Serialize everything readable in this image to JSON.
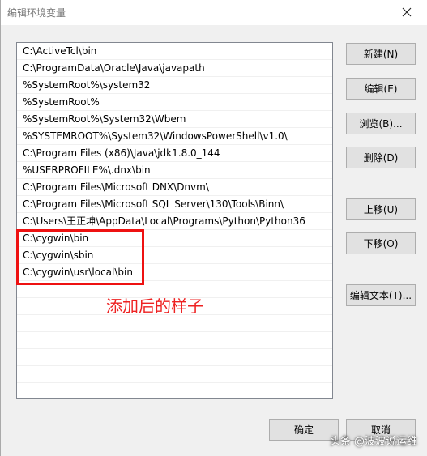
{
  "window": {
    "title": "编辑环境变量"
  },
  "paths": [
    "C:\\ActiveTcl\\bin",
    "C:\\ProgramData\\Oracle\\Java\\javapath",
    "%SystemRoot%\\system32",
    "%SystemRoot%",
    "%SystemRoot%\\System32\\Wbem",
    "%SYSTEMROOT%\\System32\\WindowsPowerShell\\v1.0\\",
    "C:\\Program Files (x86)\\Java\\jdk1.8.0_144",
    "%USERPROFILE%\\.dnx\\bin",
    "C:\\Program Files\\Microsoft DNX\\Dnvm\\",
    "C:\\Program Files\\Microsoft SQL Server\\130\\Tools\\Binn\\",
    "C:\\Users\\王正坤\\AppData\\Local\\Programs\\Python\\Python36",
    "C:\\cygwin\\bin",
    "C:\\cygwin\\sbin",
    "C:\\cygwin\\usr\\local\\bin"
  ],
  "buttons": {
    "new": "新建(N)",
    "edit": "编辑(E)",
    "browse": "浏览(B)...",
    "delete": "删除(D)",
    "move_up": "上移(U)",
    "move_down": "下移(O)",
    "edit_text": "编辑文本(T)...",
    "ok": "确定",
    "cancel": "取消"
  },
  "annotation": {
    "text": "添加后的样子",
    "color": "#ee1111"
  },
  "watermark": "头条 @波波说运维",
  "icons": {
    "close": "close-icon"
  }
}
